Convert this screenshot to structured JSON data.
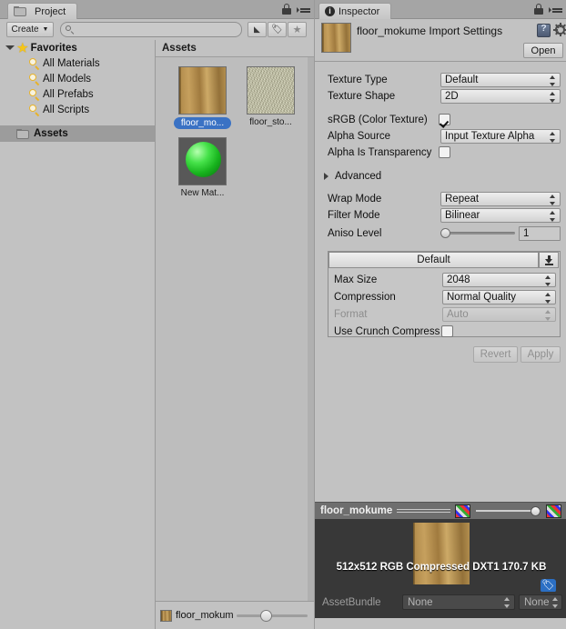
{
  "project_panel": {
    "tab_label": "Project",
    "tab_icon": "folder-icon",
    "create_button": "Create",
    "search_placeholder": "",
    "toolbar_icons": [
      "filter-by-type-icon",
      "filter-by-label-icon",
      "favorites-star-icon"
    ],
    "lock_icon": "lock-icon",
    "menu_icon": "panel-menu-icon",
    "tree": [
      {
        "label": "Favorites",
        "icon": "star-icon",
        "expanded": true,
        "depth": 0
      },
      {
        "label": "All Materials",
        "icon": "search-icon",
        "depth": 1
      },
      {
        "label": "All Models",
        "icon": "search-icon",
        "depth": 1
      },
      {
        "label": "All Prefabs",
        "icon": "search-icon",
        "depth": 1
      },
      {
        "label": "All Scripts",
        "icon": "search-icon",
        "depth": 1
      },
      {
        "label": "Assets",
        "icon": "folder-icon",
        "depth": 0,
        "selected": true
      }
    ],
    "assets_header": "Assets",
    "assets": [
      {
        "label": "floor_mo...",
        "kind": "texture-wood",
        "selected": true
      },
      {
        "label": "floor_sto...",
        "kind": "texture-stone",
        "selected": false
      },
      {
        "label": "New Mat...",
        "kind": "material-sphere",
        "selected": false
      }
    ],
    "statusbar": {
      "item_label": "floor_mokum",
      "icon": "texture-wood-icon"
    }
  },
  "inspector": {
    "tab_label": "Inspector",
    "tab_icon": "info-icon",
    "lock_icon": "lock-icon",
    "menu_icon": "panel-menu-icon",
    "title": "floor_mokume Import Settings",
    "help_icon": "help-book-icon",
    "gear_icon": "gear-icon",
    "open_button": "Open",
    "fields": [
      {
        "label": "Texture Type",
        "type": "popup",
        "value": "Default"
      },
      {
        "label": "Texture Shape",
        "type": "popup",
        "value": "2D"
      },
      {
        "label": "sRGB (Color Texture)",
        "type": "checkbox",
        "checked": true
      },
      {
        "label": "Alpha Source",
        "type": "popup",
        "value": "Input Texture Alpha"
      },
      {
        "label": "Alpha Is Transparency",
        "type": "checkbox",
        "checked": false
      },
      {
        "label": "Advanced",
        "type": "foldout",
        "expanded": false
      },
      {
        "label": "Wrap Mode",
        "type": "popup",
        "value": "Repeat"
      },
      {
        "label": "Filter Mode",
        "type": "popup",
        "value": "Bilinear"
      },
      {
        "label": "Aniso Level",
        "type": "slider",
        "value": "1",
        "min": 0,
        "max": 16
      }
    ],
    "platform": {
      "tab_label": "Default",
      "download_icon": "add-platform-icon",
      "rows": [
        {
          "label": "Max Size",
          "type": "popup",
          "value": "2048",
          "disabled": false
        },
        {
          "label": "Compression",
          "type": "popup",
          "value": "Normal Quality",
          "disabled": false
        },
        {
          "label": "Format",
          "type": "popup",
          "value": "Auto",
          "disabled": true
        },
        {
          "label": "Use Crunch Compression",
          "type": "checkbox",
          "checked": false
        }
      ]
    },
    "revert_button": "Revert",
    "apply_button": "Apply"
  },
  "preview": {
    "title": "floor_mokume",
    "rgb_icon": "rgb-channels-icon",
    "alpha_icon": "alpha-checker-icon",
    "mip_slider_value": 1,
    "info_text": "512x512  RGB Compressed DXT1   170.7 KB",
    "tag_badge_icon": "asset-label-icon",
    "assetbundle_label": "AssetBundle",
    "assetbundle_name": "None",
    "assetbundle_variant": "None"
  }
}
